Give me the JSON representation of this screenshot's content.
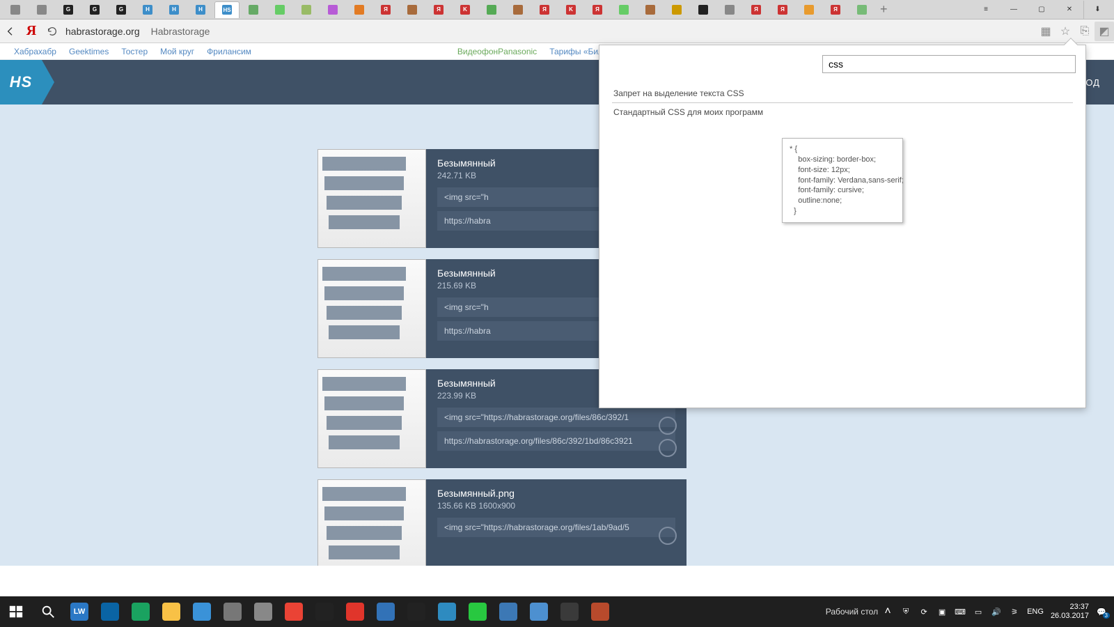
{
  "browser": {
    "tabs_count": 33,
    "active_tab_index": 8,
    "favicon_colors": [
      "#888",
      "#888",
      "#222",
      "#222",
      "#222",
      "#3d8ec9",
      "#3d8ec9",
      "#3d8ec9",
      "#3d8ec9",
      "#6a6",
      "#6c6",
      "#9b6",
      "#b75bd6",
      "#e27b24",
      "#c33",
      "#a86b3c",
      "#c33",
      "#c33",
      "#5a5",
      "#a86b3c",
      "#c33",
      "#c33",
      "#c33",
      "#6c6",
      "#a86b3c",
      "#c90",
      "#222",
      "#888",
      "#c33",
      "#c33",
      "#e89b2e",
      "#c33",
      "#7b7",
      "#c33"
    ],
    "favicon_letters": [
      "",
      "",
      "G",
      "G",
      "G",
      "H",
      "H",
      "H",
      "HS",
      "",
      "",
      "",
      "",
      "",
      "Я",
      "",
      "Я",
      "K",
      "",
      "",
      "Я",
      "K",
      "Я",
      "",
      "",
      "",
      "",
      "",
      "Я",
      "Я",
      "",
      "Я",
      "",
      "Я"
    ]
  },
  "address": {
    "domain": "habrastorage.org",
    "title": "Habrastorage"
  },
  "topnav": {
    "links": [
      "Хабрахабр",
      "Geektimes",
      "Тостер",
      "Мой круг",
      "Фрилансим"
    ],
    "promo1": "ВидеофонPanasonic",
    "promo2": "Тарифы «Билайн» Бизнес"
  },
  "hs": {
    "logo": "HS",
    "login_partial": "ОД"
  },
  "files": [
    {
      "name": "Безымянный",
      "size": "242.71 KB",
      "dims": "",
      "img": "<img src=\"h",
      "url": "https://habra"
    },
    {
      "name": "Безымянный",
      "size": "215.69 KB",
      "dims": "",
      "img": "<img src=\"h",
      "url": "https://habra"
    },
    {
      "name": "Безымянный",
      "size": "223.99 KB",
      "dims": "",
      "img": "<img src=\"https://habrastorage.org/files/86c/392/1",
      "url": "https://habrastorage.org/files/86c/392/1bd/86c3921"
    },
    {
      "name": "Безымянный.png",
      "size": "135.66 KB",
      "dims": "1600x900",
      "img": "<img src=\"https://habrastorage.org/files/1ab/9ad/5",
      "url": ""
    }
  ],
  "popup": {
    "search_value": "css",
    "rows": [
      "Запрет на выделение текста CSS",
      "Стандартный CSS для моих программ"
    ],
    "snippet": "* {\n    box-sizing: border-box;\n    font-size: 12px;\n    font-family: Verdana,sans-serif;\n    font-family: cursive;\n    outline:none;\n  }"
  },
  "taskbar": {
    "desktop_label": "Рабочий стол",
    "lang": "ENG",
    "time": "23:37",
    "date": "26.03.2017",
    "notif": "3"
  }
}
